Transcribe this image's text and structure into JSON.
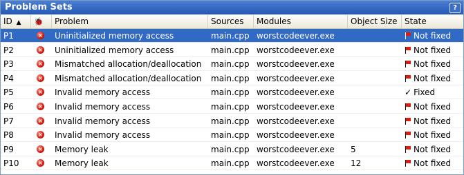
{
  "panel": {
    "title": "Problem Sets",
    "help_label": "?"
  },
  "columns": {
    "id": "ID",
    "sort_indicator": "▲",
    "icon_col": "🐞",
    "problem": "Problem",
    "sources": "Sources",
    "modules": "Modules",
    "object_size": "Object Size",
    "state": "State"
  },
  "rows": [
    {
      "id": "P1",
      "problem": "Uninitialized memory access",
      "sources": "main.cpp",
      "modules": "worstcodeever.exe",
      "size": "",
      "state": "Not fixed",
      "state_icon": "flag-icon"
    },
    {
      "id": "P2",
      "problem": "Uninitialized memory access",
      "sources": "main.cpp",
      "modules": "worstcodeever.exe",
      "size": "",
      "state": "Not fixed",
      "state_icon": "flag-icon"
    },
    {
      "id": "P3",
      "problem": "Mismatched allocation/deallocation",
      "sources": "main.cpp",
      "modules": "worstcodeever.exe",
      "size": "",
      "state": "Not fixed",
      "state_icon": "flag-icon"
    },
    {
      "id": "P4",
      "problem": "Mismatched allocation/deallocation",
      "sources": "main.cpp",
      "modules": "worstcodeever.exe",
      "size": "",
      "state": "Not fixed",
      "state_icon": "flag-icon"
    },
    {
      "id": "P5",
      "problem": "Invalid memory access",
      "sources": "main.cpp",
      "modules": "worstcodeever.exe",
      "size": "",
      "state": "Fixed",
      "state_icon": "check-icon"
    },
    {
      "id": "P6",
      "problem": "Invalid memory access",
      "sources": "main.cpp",
      "modules": "worstcodeever.exe",
      "size": "",
      "state": "Not fixed",
      "state_icon": "flag-icon"
    },
    {
      "id": "P7",
      "problem": "Invalid memory access",
      "sources": "main.cpp",
      "modules": "worstcodeever.exe",
      "size": "",
      "state": "Not fixed",
      "state_icon": "flag-icon"
    },
    {
      "id": "P8",
      "problem": "Invalid memory access",
      "sources": "main.cpp",
      "modules": "worstcodeever.exe",
      "size": "",
      "state": "Not fixed",
      "state_icon": "flag-icon"
    },
    {
      "id": "P9",
      "problem": "Memory leak",
      "sources": "main.cpp",
      "modules": "worstcodeever.exe",
      "size": "5",
      "state": "Not fixed",
      "state_icon": "flag-icon"
    },
    {
      "id": "P10",
      "problem": "Memory leak",
      "sources": "main.cpp",
      "modules": "worstcodeever.exe",
      "size": "12",
      "state": "Not fixed",
      "state_icon": "flag-icon"
    }
  ],
  "selected_row": 0,
  "colors": {
    "title_bar": "#2557b5",
    "selection": "#316ac5",
    "error": "#d41a0c",
    "flag": "#e01b0b"
  }
}
